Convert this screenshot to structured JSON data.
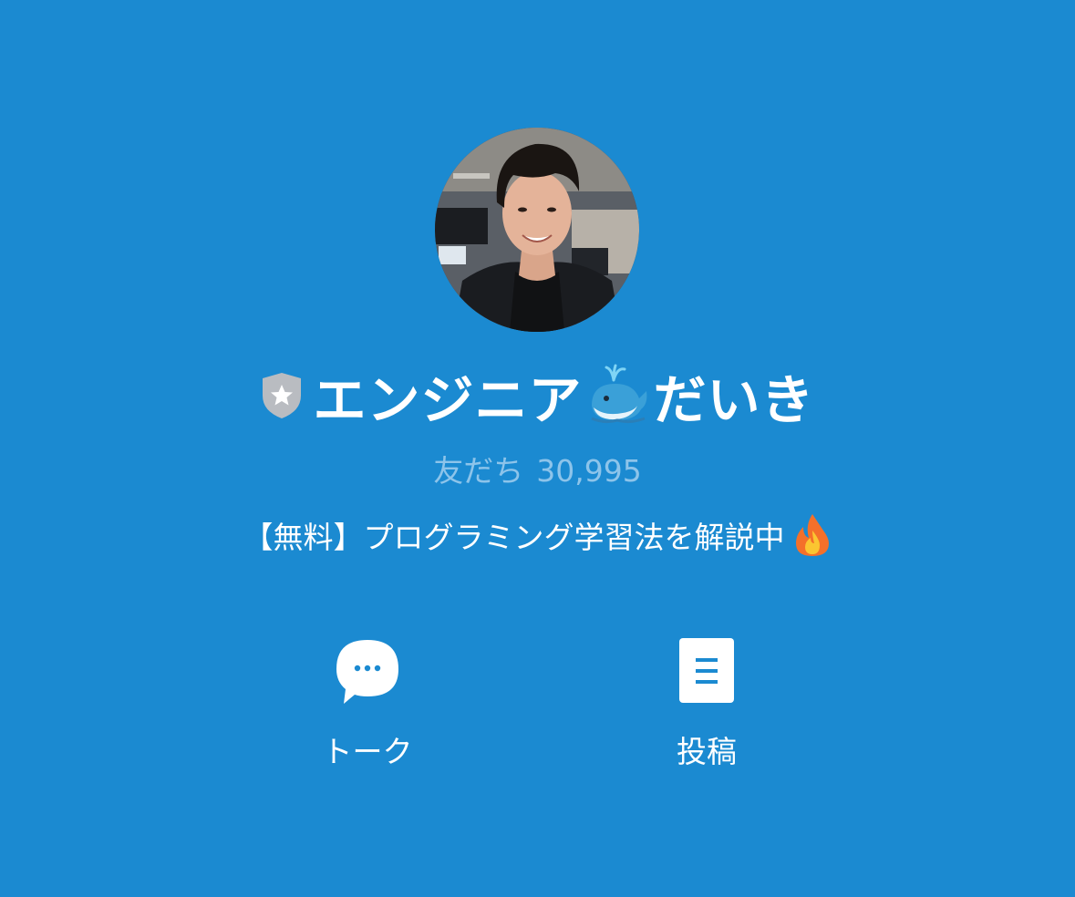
{
  "profile": {
    "name": "エンジニア",
    "name_suffix": "だいき",
    "friends_label": "友だち",
    "friends_count": "30,995",
    "status_message": "【無料】プログラミング学習法を解説中"
  },
  "icons": {
    "badge": "shield-star-icon",
    "name_emoji": "spouting-whale-emoji",
    "status_emoji": "fire-emoji"
  },
  "actions": [
    {
      "label": "トーク",
      "icon": "chat-bubble-icon"
    },
    {
      "label": "投稿",
      "icon": "posts-icon"
    }
  ],
  "colors": {
    "background": "#1b8ad1",
    "text": "#ffffff",
    "muted_text": "#8dc4ea",
    "badge": "#b9bcc1"
  }
}
